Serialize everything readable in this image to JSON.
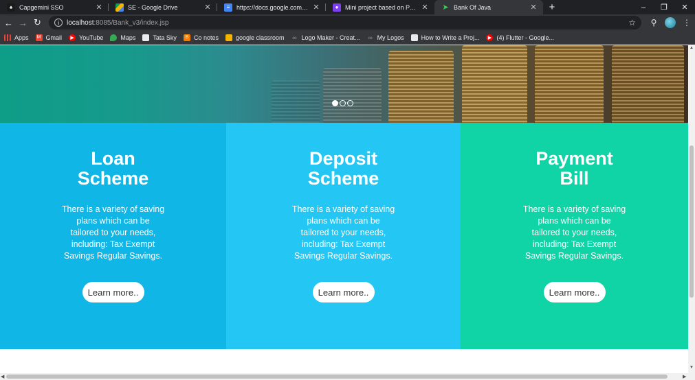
{
  "tabs": [
    {
      "title": "Capgemini SSO",
      "icon": "capgemini-icon",
      "active": false
    },
    {
      "title": "SE - Google Drive",
      "icon": "google-drive-icon",
      "active": false
    },
    {
      "title": "https://docs.google.com/docum",
      "icon": "google-docs-icon",
      "active": false
    },
    {
      "title": "Mini project based on Part I and",
      "icon": "google-forms-icon",
      "active": false
    },
    {
      "title": "Bank Of Java",
      "icon": "bank-of-java-icon",
      "active": true
    }
  ],
  "address": {
    "host": "localhost",
    "path": ":8085/Bank_v3/index.jsp"
  },
  "bookmarks": [
    {
      "label": "Apps",
      "icon": "apps-grid-icon",
      "color": "#e8eaed"
    },
    {
      "label": "Gmail",
      "icon": "gmail-icon",
      "color": "#ea4335"
    },
    {
      "label": "YouTube",
      "icon": "youtube-icon",
      "color": "#ff0000"
    },
    {
      "label": "Maps",
      "icon": "maps-icon",
      "color": "#34a853"
    },
    {
      "label": "Tata Sky",
      "icon": "tata-sky-icon",
      "color": "#e8eaed"
    },
    {
      "label": "Co notes",
      "icon": "blogger-icon",
      "color": "#f57d00"
    },
    {
      "label": "google classroom",
      "icon": "classroom-icon",
      "color": "#f4b400"
    },
    {
      "label": "Logo Maker - Creat...",
      "icon": "logo-maker-icon",
      "color": "#8a8f94"
    },
    {
      "label": "My Logos",
      "icon": "logo-maker-icon",
      "color": "#8a8f94"
    },
    {
      "label": "How to Write a Proj...",
      "icon": "doc-icon",
      "color": "#e8eaed"
    },
    {
      "label": "(4) Flutter - Google...",
      "icon": "youtube-icon",
      "color": "#ff0000"
    }
  ],
  "carousel": {
    "slides": 3,
    "active_slide": 1
  },
  "panels": [
    {
      "title_line1": "Loan",
      "title_line2": "Scheme",
      "description": "There is a variety of saving plans which can be tailored to your needs, including: Tax Exempt Savings Regular Savings.",
      "button": "Learn more..",
      "color": "#10b6e6"
    },
    {
      "title_line1": "Deposit",
      "title_line2": "Scheme",
      "description": "There is a variety of saving plans which can be tailored to your needs, including: Tax Exempt Savings Regular Savings.",
      "button": "Learn more..",
      "color": "#24c6f3"
    },
    {
      "title_line1": "Payment",
      "title_line2": "Bill",
      "description": "There is a variety of saving plans which can be tailored to your needs, including: Tax Exempt Savings Regular Savings.",
      "button": "Learn more..",
      "color": "#10d4a6"
    }
  ],
  "colors": {
    "chrome_dark": "#202124",
    "chrome_toolbar": "#35363a"
  }
}
